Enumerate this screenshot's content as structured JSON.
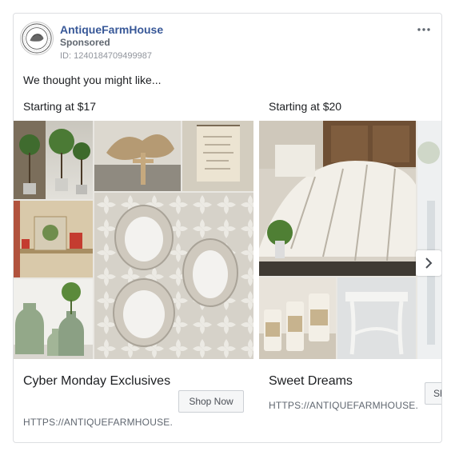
{
  "header": {
    "page_name": "AntiqueFarmHouse",
    "sponsored_label": "Sponsored",
    "ad_id": "ID: 1240184709499987",
    "more_icon": "more-horizontal-icon"
  },
  "message": "We thought you might like...",
  "carousel": {
    "cards": [
      {
        "price": "Starting at $17",
        "title": "Cyber Monday Exclusives",
        "url": "HTTPS://ANTIQUEFARMHOUSE.",
        "button": "Shop Now"
      },
      {
        "price": "Starting at $20",
        "title": "Sweet Dreams",
        "url": "HTTPS://ANTIQUEFARMHOUSE.",
        "button": "Sh"
      }
    ],
    "next_icon": "chevron-right-icon"
  },
  "colors": {
    "link": "#385898",
    "secondary_text": "#606770",
    "border": "#dddfe2"
  }
}
